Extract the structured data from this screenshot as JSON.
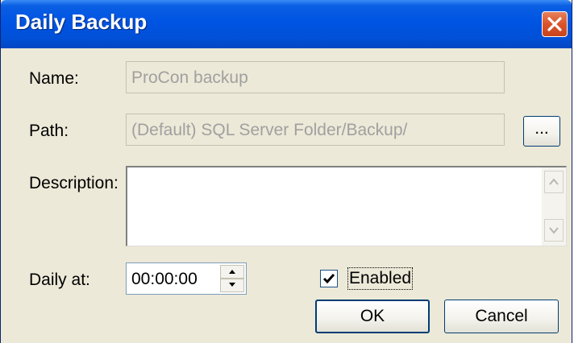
{
  "window": {
    "title": "Daily Backup"
  },
  "form": {
    "name_label": "Name:",
    "name_value": "ProCon backup",
    "path_label": "Path:",
    "path_value": "(Default) SQL Server Folder/Backup/",
    "browse_label": "...",
    "description_label": "Description:",
    "description_value": "",
    "daily_at_label": "Daily at:",
    "daily_at_value": "00:00:00",
    "enabled_label": "Enabled",
    "enabled_checked": true
  },
  "buttons": {
    "ok_label": "OK",
    "cancel_label": "Cancel"
  },
  "icons": {
    "close": "close-icon",
    "scroll_up": "arrow-up-icon",
    "scroll_down": "arrow-down-icon",
    "spin_up": "arrow-up-icon",
    "spin_down": "arrow-down-icon",
    "check": "checkmark-icon"
  },
  "colors": {
    "titlebar": "#0054e3",
    "dialog_bg": "#ece9d8",
    "close_button": "#d9542b",
    "disabled_text": "#a0a0a0"
  }
}
